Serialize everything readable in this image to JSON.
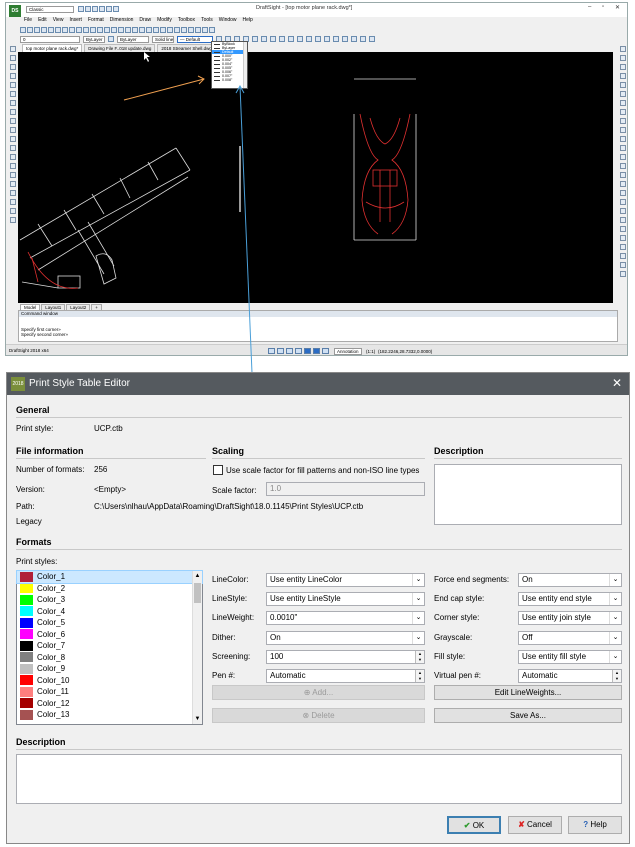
{
  "draftsight": {
    "title": "DraftSight - [top motor plane rack.dwg*]",
    "logo": "DS",
    "window_controls": [
      "–",
      "▫",
      "✕"
    ],
    "workspace_combo": "Classic",
    "menu": [
      "File",
      "Edit",
      "View",
      "Insert",
      "Format",
      "Dimension",
      "Draw",
      "Modify",
      "Toolbox",
      "Tools",
      "Window",
      "Help"
    ],
    "layer_combo": "0",
    "color_combo": "ByLayer",
    "linestyle_combo": "ByLayer",
    "line_combo": "Solid line",
    "lineweight_combo": "— Default",
    "lineweight_dropdown": {
      "items": [
        "ByBlock",
        "ByLayer",
        "Default",
        "0.000\"",
        "0.002\"",
        "0.004\"",
        "0.005\"",
        "0.006\"",
        "0.007\"",
        "0.008\""
      ],
      "selected_index": 2
    },
    "tabs": [
      "top motor plane rack.dwg*",
      "Drawing File F..018 update.dwg",
      "2018 Streamer Shell.dwg"
    ],
    "layout_tabs": [
      "Model",
      "Layout1",
      "Layout2",
      "+"
    ],
    "command_window": {
      "header": "Command window",
      "lines": [
        "Specify first corner»",
        "Specify second corner»"
      ]
    },
    "status": {
      "left": "DraftSight 2018 x64",
      "annotation": "Annotation",
      "scale": "(1:1)",
      "coords": "(182.2246,28.7332,0.0000)"
    }
  },
  "dialog": {
    "title": "Print Style Table Editor",
    "logo": "2018",
    "close": "✕",
    "general": {
      "heading": "General",
      "print_style_label": "Print style:",
      "print_style_value": "UCP.ctb"
    },
    "file_information": {
      "heading": "File information",
      "number_label": "Number of formats:",
      "number_value": "256",
      "version_label": "Version:",
      "version_value": "<Empty>",
      "path_label": "Path:",
      "path_value": "C:\\Users\\nlhau\\AppData\\Roaming\\DraftSight\\18.0.1145\\Print Styles\\UCP.ctb",
      "legacy": "Legacy"
    },
    "scaling": {
      "heading": "Scaling",
      "checkbox_label": "Use scale factor for fill patterns and non-ISO line types",
      "checked": false,
      "factor_label": "Scale factor:",
      "factor_value": "1.0"
    },
    "description_heading": "Description",
    "formats": {
      "heading": "Formats",
      "print_styles_label": "Print styles:",
      "styles": [
        {
          "name": "Color_1",
          "color": "#b0203a",
          "selected": true
        },
        {
          "name": "Color_2",
          "color": "#ffff00"
        },
        {
          "name": "Color_3",
          "color": "#00ff00"
        },
        {
          "name": "Color_4",
          "color": "#00ffff"
        },
        {
          "name": "Color_5",
          "color": "#0000ff"
        },
        {
          "name": "Color_6",
          "color": "#ff00ff"
        },
        {
          "name": "Color_7",
          "color": "#000000"
        },
        {
          "name": "Color_8",
          "color": "#808080"
        },
        {
          "name": "Color_9",
          "color": "#c0c0c0"
        },
        {
          "name": "Color_10",
          "color": "#ff0000"
        },
        {
          "name": "Color_11",
          "color": "#ff7f7f"
        },
        {
          "name": "Color_12",
          "color": "#a50000"
        },
        {
          "name": "Color_13",
          "color": "#a55252"
        }
      ],
      "props_left": [
        {
          "label": "LineColor:",
          "value": "Use entity LineColor",
          "kind": "select"
        },
        {
          "label": "LineStyle:",
          "value": "Use entity LineStyle",
          "kind": "select"
        },
        {
          "label": "LineWeight:",
          "value": "0.0010\"",
          "kind": "select"
        },
        {
          "label": "Dither:",
          "value": "On",
          "kind": "select"
        },
        {
          "label": "Screening:",
          "value": "100",
          "kind": "spin"
        },
        {
          "label": "Pen #:",
          "value": "Automatic",
          "kind": "spin"
        }
      ],
      "props_right": [
        {
          "label": "Force end segments:",
          "value": "On",
          "kind": "select"
        },
        {
          "label": "End cap style:",
          "value": "Use entity end style",
          "kind": "select"
        },
        {
          "label": "Corner style:",
          "value": "Use entity join style",
          "kind": "select"
        },
        {
          "label": "Grayscale:",
          "value": "Off",
          "kind": "select"
        },
        {
          "label": "Fill style:",
          "value": "Use entity fill style",
          "kind": "select"
        },
        {
          "label": "Virtual pen #:",
          "value": "Automatic",
          "kind": "spin"
        }
      ],
      "add_button": "Add...",
      "delete_button": "Delete",
      "edit_lineweights_button": "Edit LineWeights...",
      "save_as_button": "Save As..."
    },
    "bottom_description_heading": "Description",
    "ok": "OK",
    "cancel": "Cancel",
    "help": "Help"
  }
}
